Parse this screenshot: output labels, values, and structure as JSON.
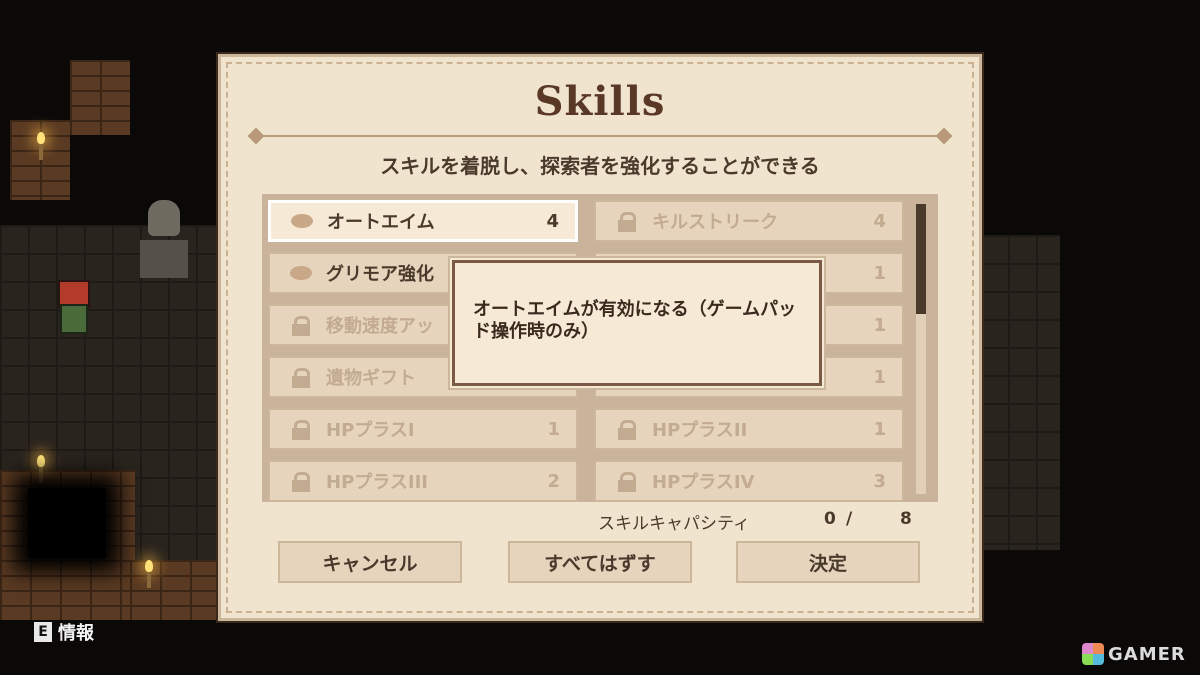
{
  "dialog": {
    "title": "Skills",
    "subtitle": "スキルを着脱し、探索者を強化することができる",
    "skills": [
      {
        "name": "オートエイム",
        "cost": "4",
        "state": "selected",
        "icon": "dot-icon"
      },
      {
        "name": "キルストリーク",
        "cost": "4",
        "state": "locked",
        "icon": "lock-icon"
      },
      {
        "name": "グリモア強化",
        "cost": "",
        "state": "unlocked",
        "icon": "dot-icon"
      },
      {
        "name": "",
        "cost": "1",
        "state": "locked",
        "icon": "lock-icon"
      },
      {
        "name": "移動速度アッ",
        "cost": "",
        "state": "locked",
        "icon": "lock-icon"
      },
      {
        "name": "",
        "cost": "1",
        "state": "locked",
        "icon": "lock-icon"
      },
      {
        "name": "遺物ギフト",
        "cost": "",
        "state": "locked",
        "icon": "lock-icon"
      },
      {
        "name": "",
        "cost": "1",
        "state": "locked",
        "icon": "lock-icon"
      },
      {
        "name": "HPプラスI",
        "cost": "1",
        "state": "locked",
        "icon": "lock-icon"
      },
      {
        "name": "HPプラスII",
        "cost": "1",
        "state": "locked",
        "icon": "lock-icon"
      },
      {
        "name": "HPプラスIII",
        "cost": "2",
        "state": "locked",
        "icon": "lock-icon"
      },
      {
        "name": "HPプラスIV",
        "cost": "3",
        "state": "locked",
        "icon": "lock-icon"
      }
    ],
    "tooltip": "オートエイムが有効になる（ゲームパッド操作時のみ）",
    "capacity": {
      "label": "スキルキャパシティ",
      "used": "0",
      "slash": "/",
      "max": "8"
    },
    "buttons": {
      "cancel": "キャンセル",
      "unequip_all": "すべてはずす",
      "confirm": "決定"
    }
  },
  "hud": {
    "info_key": "E",
    "info_label": "情報"
  },
  "watermark": "GAMER",
  "colors": {
    "panel": "#f1e4cf",
    "text": "#4a3a2c",
    "locked": "#c2ab91",
    "border": "#7a5a44"
  }
}
